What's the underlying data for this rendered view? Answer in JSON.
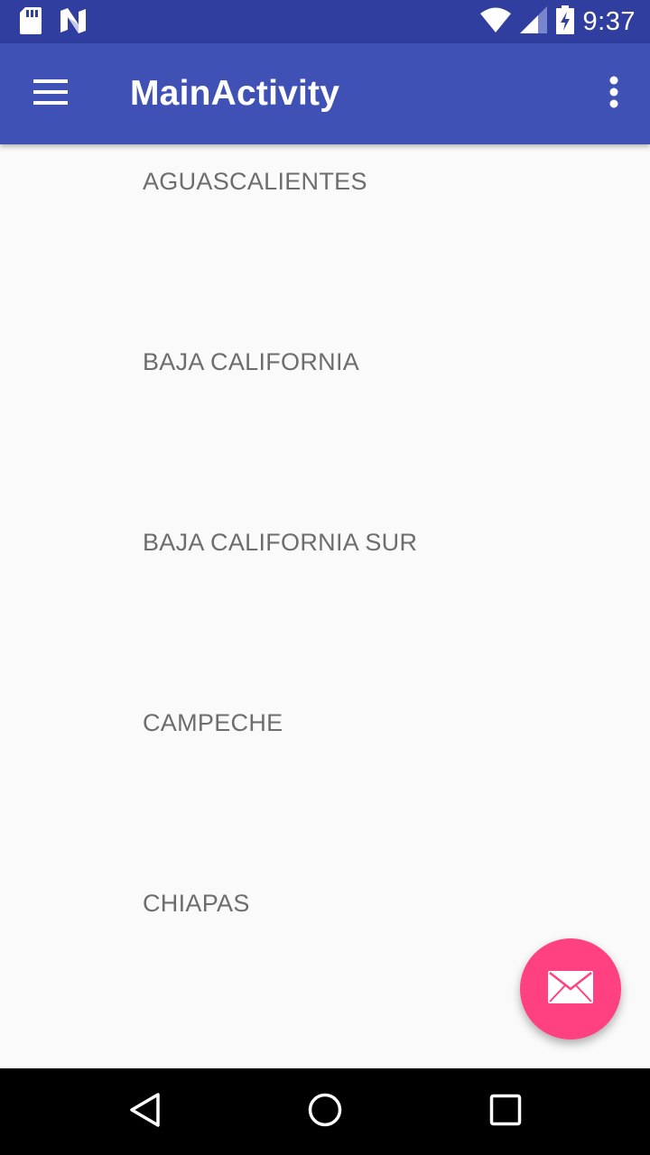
{
  "status_bar": {
    "time": "9:37",
    "icons": [
      "sd-card-icon",
      "n-notification-icon",
      "wifi-icon",
      "cell-signal-icon",
      "battery-charging-icon"
    ]
  },
  "app_bar": {
    "title": "MainActivity",
    "menu_icon": "hamburger-menu-icon",
    "overflow_icon": "more-vert-icon"
  },
  "list": {
    "items": [
      {
        "label": "AGUASCALIENTES"
      },
      {
        "label": "BAJA CALIFORNIA"
      },
      {
        "label": "BAJA CALIFORNIA SUR"
      },
      {
        "label": "CAMPECHE"
      },
      {
        "label": "CHIAPAS"
      }
    ]
  },
  "fab": {
    "icon": "email-icon"
  },
  "nav_bar": {
    "icons": [
      "back-icon",
      "home-icon",
      "recents-icon"
    ]
  },
  "colors": {
    "primary": "#3f51b5",
    "primary_dark": "#303f9f",
    "accent": "#ff4081",
    "background": "#fafafa",
    "text_secondary": "#6d6d6d"
  }
}
